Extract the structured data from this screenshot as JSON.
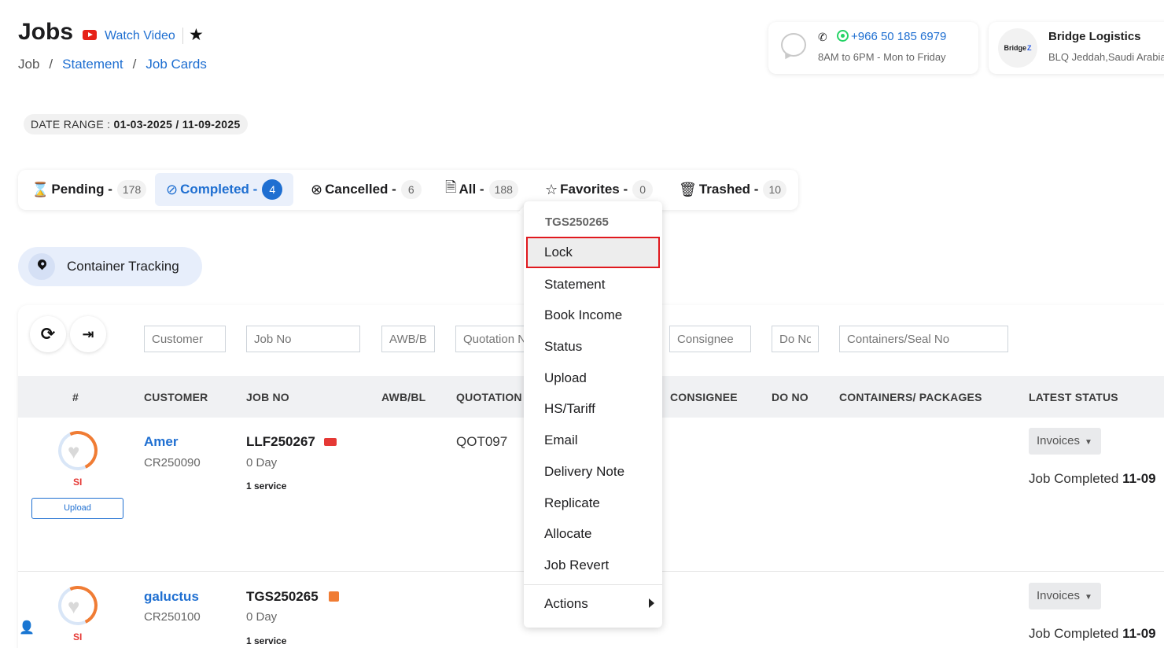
{
  "header": {
    "title": "Jobs",
    "watch_video": "Watch Video",
    "breadcrumb": [
      "Job",
      "Statement",
      "Job Cards"
    ],
    "breadcrumb_sep": "/"
  },
  "contact": {
    "phone": "+966 50 185 6979",
    "hours": "8AM to 6PM - Mon to Friday"
  },
  "company": {
    "logo_text": "Bridge",
    "name": "Bridge Logistics",
    "location": "BLQ Jeddah,Saudi Arabia"
  },
  "date_range": {
    "label": "DATE RANGE : ",
    "value": "01-03-2025 / 11-09-2025"
  },
  "tabs": [
    {
      "label": "Pending -",
      "count": "178",
      "icon": "hourglass-icon",
      "active": false
    },
    {
      "label": "Completed -",
      "count": "4",
      "icon": "check-circle-icon",
      "active": true
    },
    {
      "label": "Cancelled -",
      "count": "6",
      "icon": "x-circle-icon",
      "active": false
    },
    {
      "label": "All -",
      "count": "188",
      "icon": "document-icon",
      "active": false
    },
    {
      "label": "Favorites -",
      "count": "0",
      "icon": "star-icon",
      "active": false
    },
    {
      "label": "Trashed -",
      "count": "10",
      "icon": "trash-icon",
      "active": false
    }
  ],
  "container_tracking": "Container Tracking",
  "filters": {
    "customer": "Customer",
    "job_no": "Job No",
    "awb": "AWB/B",
    "quotation": "Quotation N",
    "consignee": "Consignee",
    "do_no": "Do No",
    "containers": "Containers/Seal No"
  },
  "columns": {
    "index": "#",
    "customer": "CUSTOMER",
    "job_no": "JOB NO",
    "awb": "AWB/BL",
    "quotation": "QUOTATION",
    "consignee": "CONSIGNEE",
    "do_no": "DO NO",
    "containers": "CONTAINERS/ PACKAGES",
    "latest_status": "LATEST STATUS"
  },
  "rows": [
    {
      "badge": "SI",
      "upload": "Upload",
      "customer": "Amer",
      "customer_code": "CR250090",
      "job_no": "LLF250267",
      "days": "0 Day",
      "services": "1 service",
      "quotation": "QOT097",
      "invoices": "Invoices",
      "status": "Job Completed ",
      "status_date": "11-09"
    },
    {
      "badge": "SI",
      "customer": "galuctus",
      "customer_code": "CR250100",
      "job_no": "TGS250265",
      "days": "0 Day",
      "services": "1 service",
      "invoices": "Invoices",
      "status": "Job Completed ",
      "status_date": "11-09"
    }
  ],
  "context_menu": {
    "title": "TGS250265",
    "items": [
      "Lock",
      "Statement",
      "Book Income",
      "Status",
      "Upload",
      "HS/Tariff",
      "Email",
      "Delivery Note",
      "Replicate",
      "Allocate",
      "Job Revert"
    ],
    "highlighted": "Lock",
    "actions": "Actions"
  }
}
